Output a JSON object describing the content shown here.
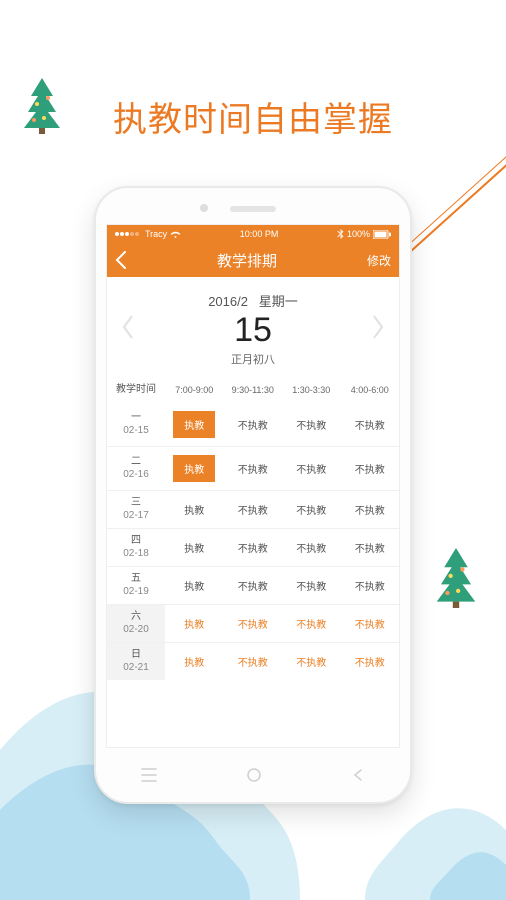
{
  "colors": {
    "accent": "#eb8227"
  },
  "hero": "执教时间自由掌握",
  "statusbar": {
    "carrier": "Tracy",
    "time": "10:00 PM",
    "battery": "100%"
  },
  "header": {
    "title": "教学排期",
    "modify": "修改"
  },
  "date": {
    "year_month": "2016/2",
    "weekday": "星期一",
    "day": "15",
    "lunar": "正月初八"
  },
  "table": {
    "day_col": "教学时间",
    "slots": [
      "7:00-9:00",
      "9:30-11:30",
      "1:30-3:30",
      "4:00-6:00"
    ],
    "teach": "执教",
    "no_teach": "不执教",
    "rows": [
      {
        "dw": "一",
        "dt": "02-15",
        "cells": [
          "teach_hl",
          "no",
          "no",
          "no"
        ],
        "weekend": false
      },
      {
        "dw": "二",
        "dt": "02-16",
        "cells": [
          "teach_hl",
          "no",
          "no",
          "no"
        ],
        "weekend": false
      },
      {
        "dw": "三",
        "dt": "02-17",
        "cells": [
          "teach",
          "no",
          "no",
          "no"
        ],
        "weekend": false
      },
      {
        "dw": "四",
        "dt": "02-18",
        "cells": [
          "teach",
          "no",
          "no",
          "no"
        ],
        "weekend": false
      },
      {
        "dw": "五",
        "dt": "02-19",
        "cells": [
          "teach",
          "no",
          "no",
          "no"
        ],
        "weekend": false
      },
      {
        "dw": "六",
        "dt": "02-20",
        "cells": [
          "teach",
          "no",
          "no",
          "no"
        ],
        "weekend": true
      },
      {
        "dw": "日",
        "dt": "02-21",
        "cells": [
          "teach",
          "no",
          "no",
          "no"
        ],
        "weekend": true
      }
    ]
  }
}
